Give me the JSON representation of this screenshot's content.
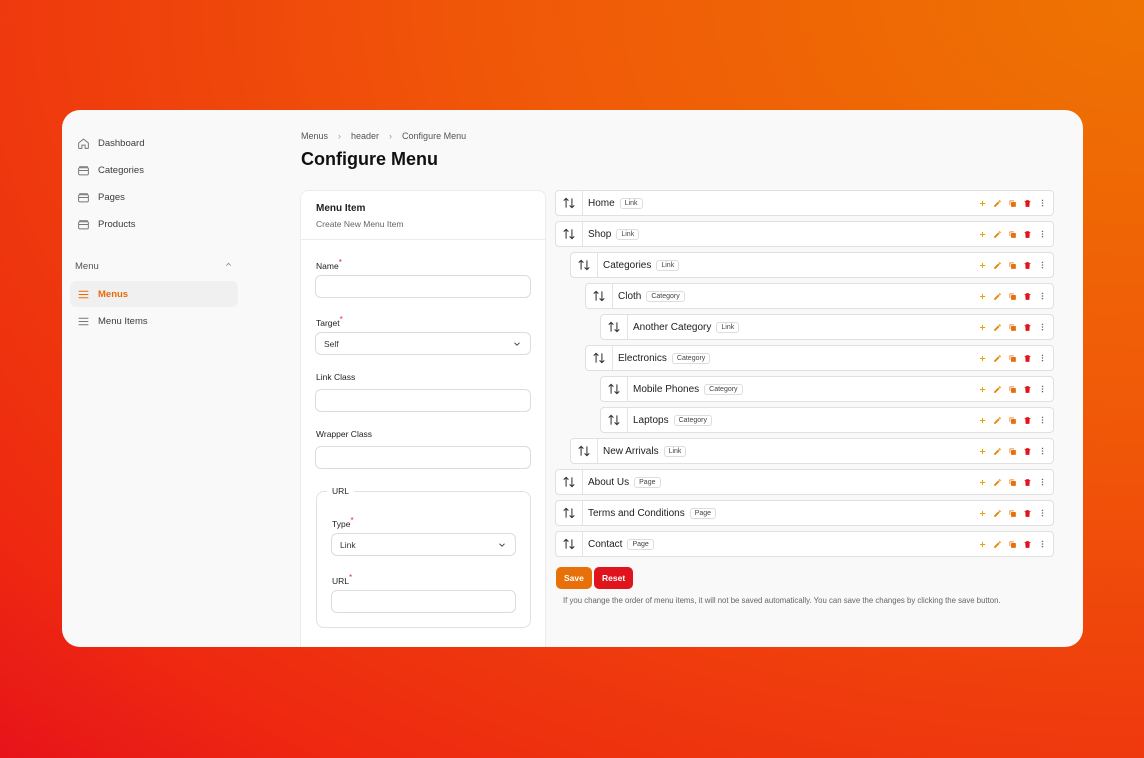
{
  "sidebar": {
    "items": [
      {
        "label": "Dashboard",
        "icon": "home-icon"
      },
      {
        "label": "Categories",
        "icon": "folder-icon"
      },
      {
        "label": "Pages",
        "icon": "folder-icon"
      },
      {
        "label": "Products",
        "icon": "folder-icon"
      }
    ],
    "group": {
      "label": "Menu",
      "items": [
        {
          "label": "Menus",
          "icon": "list-icon",
          "active": true
        },
        {
          "label": "Menu Items",
          "icon": "list-icon",
          "active": false
        }
      ]
    }
  },
  "breadcrumb": [
    "Menus",
    "header",
    "Configure Menu"
  ],
  "page": {
    "title": "Configure Menu"
  },
  "form": {
    "title": "Menu Item",
    "subtitle": "Create New Menu Item",
    "name_label": "Name",
    "name_value": "",
    "target_label": "Target",
    "target_value": "Self",
    "link_class_label": "Link Class",
    "link_class_value": "",
    "wrapper_class_label": "Wrapper Class",
    "wrapper_class_value": "",
    "url_section": "URL",
    "type_label": "Type",
    "type_value": "Link",
    "url_label": "URL",
    "url_value": ""
  },
  "tree": [
    {
      "label": "Home",
      "badge": "Link",
      "depth": 0
    },
    {
      "label": "Shop",
      "badge": "Link",
      "depth": 0
    },
    {
      "label": "Categories",
      "badge": "Link",
      "depth": 1
    },
    {
      "label": "Cloth",
      "badge": "Category",
      "depth": 2
    },
    {
      "label": "Another Category",
      "badge": "Link",
      "depth": 3
    },
    {
      "label": "Electronics",
      "badge": "Category",
      "depth": 2
    },
    {
      "label": "Mobile Phones",
      "badge": "Category",
      "depth": 3
    },
    {
      "label": "Laptops",
      "badge": "Category",
      "depth": 3
    },
    {
      "label": "New Arrivals",
      "badge": "Link",
      "depth": 1
    },
    {
      "label": "About Us",
      "badge": "Page",
      "depth": 0
    },
    {
      "label": "Terms and Conditions",
      "badge": "Page",
      "depth": 0
    },
    {
      "label": "Contact",
      "badge": "Page",
      "depth": 0
    }
  ],
  "actions": {
    "save_label": "Save",
    "reset_label": "Reset",
    "hint": "If you change the order of menu items, it will not be saved automatically. You can save the changes by clicking the save button."
  },
  "colors": {
    "accent": "#e8700a",
    "danger": "#e0141d",
    "add_icon": "#e8a10a",
    "edit_icon": "#e88a0a",
    "duplicate_icon": "#e8700a",
    "delete_icon": "#e0141d"
  }
}
